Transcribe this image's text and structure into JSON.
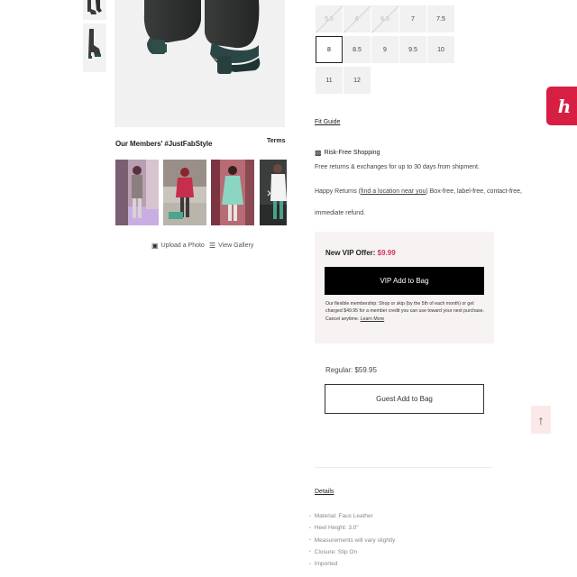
{
  "gallery": {
    "members_title": "Our Members' #JustFabStyle",
    "terms_label": "Terms",
    "next_icon": "chevron-right-icon",
    "upload_label": "Upload a Photo",
    "view_gallery_label": "View Gallery"
  },
  "sizes": [
    {
      "label": "5.5",
      "available": false,
      "selected": false
    },
    {
      "label": "6",
      "available": false,
      "selected": false
    },
    {
      "label": "6.5",
      "available": false,
      "selected": false
    },
    {
      "label": "7",
      "available": true,
      "selected": false
    },
    {
      "label": "7.5",
      "available": true,
      "selected": false
    },
    {
      "label": "8",
      "available": true,
      "selected": true
    },
    {
      "label": "8.5",
      "available": true,
      "selected": false
    },
    {
      "label": "9",
      "available": true,
      "selected": false
    },
    {
      "label": "9.5",
      "available": true,
      "selected": false
    },
    {
      "label": "10",
      "available": true,
      "selected": false
    },
    {
      "label": "11",
      "available": true,
      "selected": false
    },
    {
      "label": "12",
      "available": true,
      "selected": false
    }
  ],
  "fit_guide": "Fit Guide",
  "risk_free": {
    "title": "Risk-Free Shopping",
    "line1": "Free returns & exchanges for up to 30 days from shipment.",
    "happy_prefix": "Happy Returns (",
    "happy_link": "find a location near you",
    "happy_suffix": ") Box-free, label-free, contact-free,",
    "line3": "immediate refund."
  },
  "vip": {
    "offer_label": "New VIP Offer:",
    "offer_price": "$9.99",
    "button_label": "VIP Add to Bag",
    "fine_1": "Our flexible membership: Shop or skip (by the 5th of each month) or get",
    "fine_2": "charged $49.95 for a member credit you can use toward your next purchase.",
    "fine_3": "Cancel anytime.",
    "learn_more": "Learn More"
  },
  "regular": {
    "label": "Regular:",
    "price": "$59.95",
    "button_label": "Guest Add to Bag"
  },
  "details": {
    "title": "Details",
    "items": [
      "Material: Faux Leather",
      "Heel Height: 3.0\"",
      "Measurements will vary slightly",
      "Closure: Slip On",
      "Imported"
    ]
  },
  "widgets": {
    "honey_glyph": "h",
    "back_to_top_icon": "arrow-up-icon"
  },
  "colors": {
    "accent": "#d6335a",
    "honey": "#d61f42",
    "vip_bg": "#f7f3f2"
  }
}
